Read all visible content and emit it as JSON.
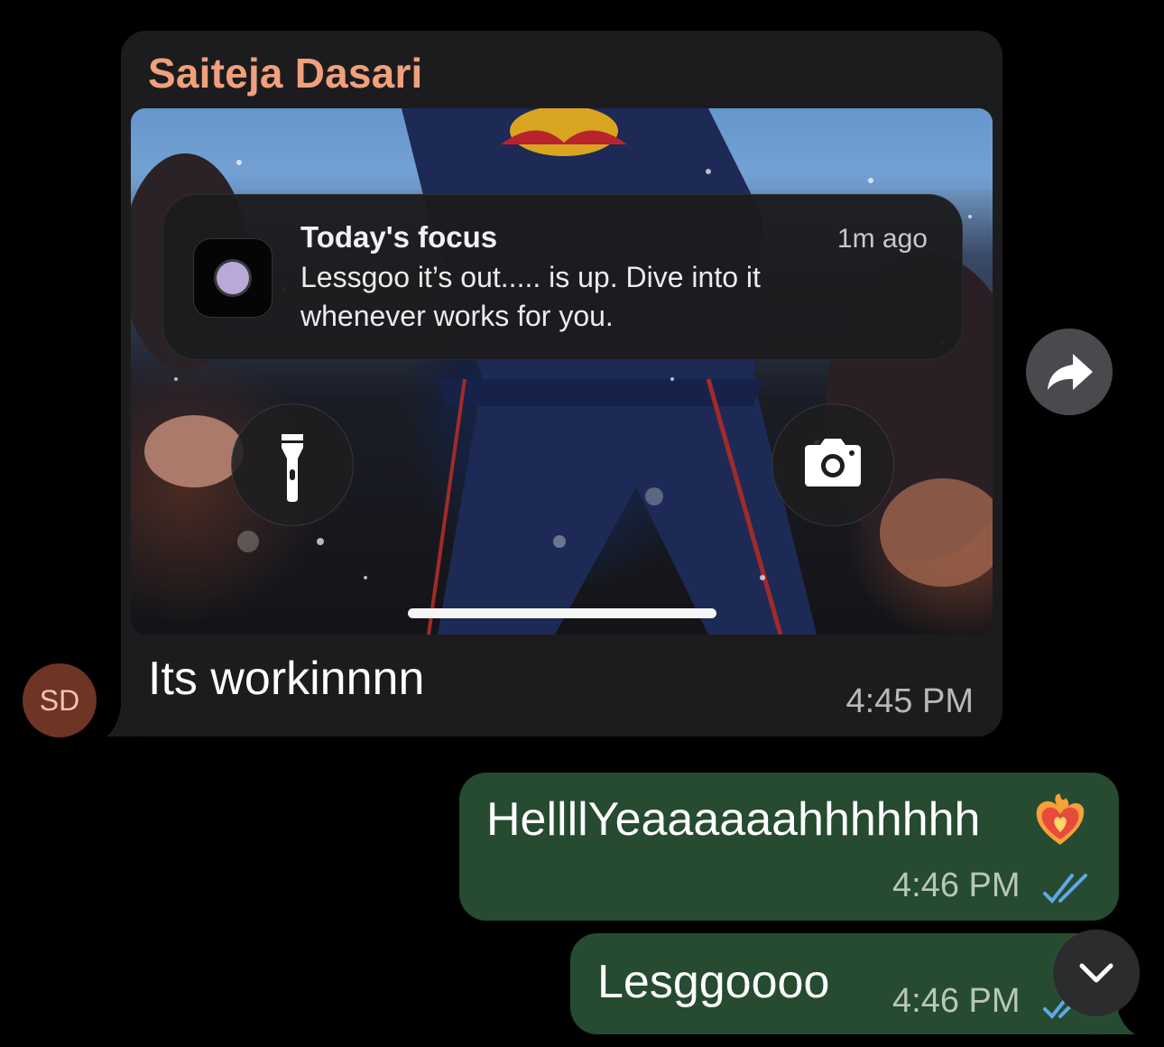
{
  "incoming": {
    "sender": "Saiteja Dasari",
    "avatar_initials": "SD",
    "text": "Its workinnnn",
    "time": "4:45 PM",
    "image": {
      "notification": {
        "title": "Today's focus",
        "time": "1m ago",
        "body": "Lessgoo it’s out..... is up. Dive into it whenever works for you.",
        "app_icon": "app-icon"
      },
      "left_button_icon": "flashlight-icon",
      "right_button_icon": "camera-icon"
    }
  },
  "outgoing": [
    {
      "text": "HellllYeaaaaaahhhhhhh",
      "emoji": "heart-on-fire",
      "time": "4:46 PM",
      "status": "read"
    },
    {
      "text": "Lesggoooo",
      "time": "4:46 PM",
      "status": "read"
    }
  ],
  "controls": {
    "forward_icon": "forward-icon",
    "scroll_icon": "chevron-down-icon"
  },
  "colors": {
    "background": "#000000",
    "incoming_bubble": "#1c1c1e",
    "outgoing_bubble": "#264b30",
    "sender_name": "#f0a07c",
    "read_ticks": "#5fa8e8",
    "avatar": "#6e3424"
  }
}
